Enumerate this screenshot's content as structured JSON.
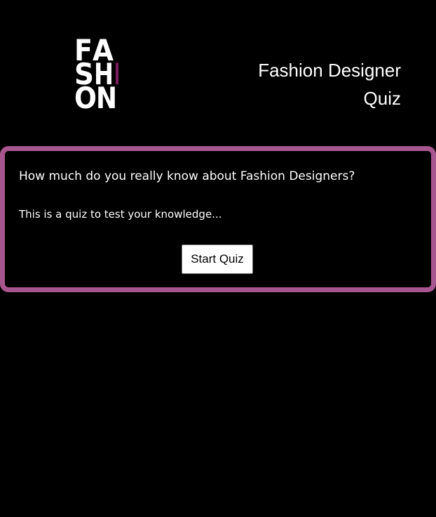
{
  "header": {
    "logo": {
      "letters": [
        "F",
        "A",
        "S",
        "H",
        "I",
        "O",
        "N"
      ],
      "accent_color": "#7a1f5c"
    },
    "title": "Fashion Designer Quiz"
  },
  "intro": {
    "question": "How much do you really know about Fashion Designers?",
    "description": "This is a quiz to test your knowledge...",
    "start_label": "Start Quiz",
    "border_color": "#a8568f"
  }
}
